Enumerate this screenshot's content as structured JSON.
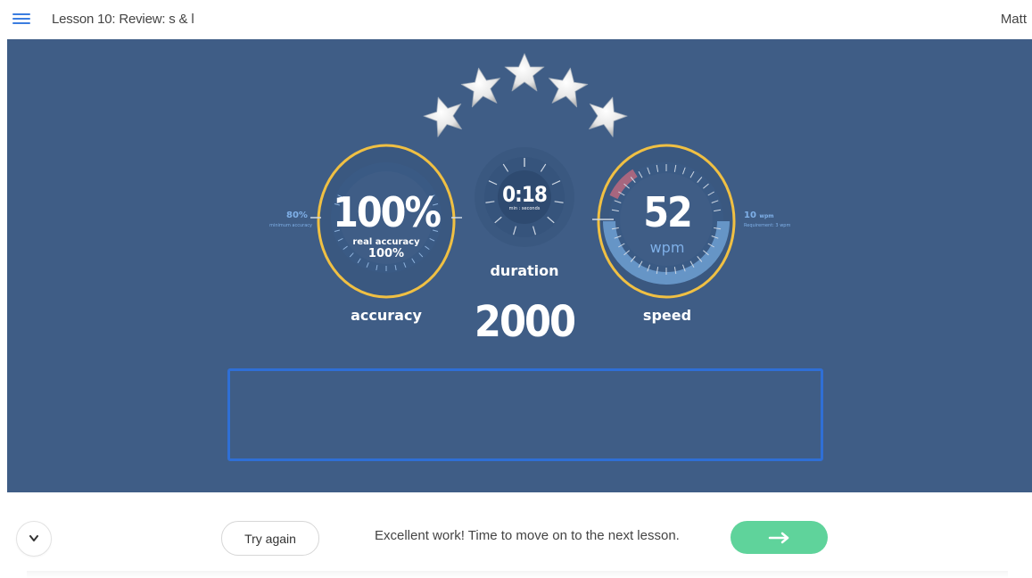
{
  "header": {
    "menu_icon": "hamburger-menu-icon",
    "title": "Lesson 10: Review: s & l",
    "user": "Matt"
  },
  "results": {
    "stars_earned": 5,
    "stars_total": 5,
    "accuracy": {
      "value": "100%",
      "real_label": "real accuracy",
      "real_value": "100%",
      "label": "accuracy",
      "minimum_value": "80%",
      "minimum_label": "minimum accuracy",
      "ring_fraction": 1.0
    },
    "duration": {
      "value": "0:18",
      "unit_label": "min : seconds",
      "label": "duration"
    },
    "score": "2000",
    "speed": {
      "value": "52",
      "unit": "wpm",
      "label": "speed",
      "requirement_value": "10",
      "requirement_unit": "wpm",
      "requirement_label": "Requirement: 3 wpm"
    }
  },
  "footer": {
    "collapse_icon": "chevron-down-icon",
    "try_again_label": "Try again",
    "message": "Excellent work! Time to move on to the next lesson.",
    "next_icon": "arrow-right-icon"
  },
  "colors": {
    "stage_bg": "#3f5d86",
    "ring_gold": "#f0c043",
    "accent_blue": "#2f6fd6",
    "next_green": "#5fd39b"
  }
}
